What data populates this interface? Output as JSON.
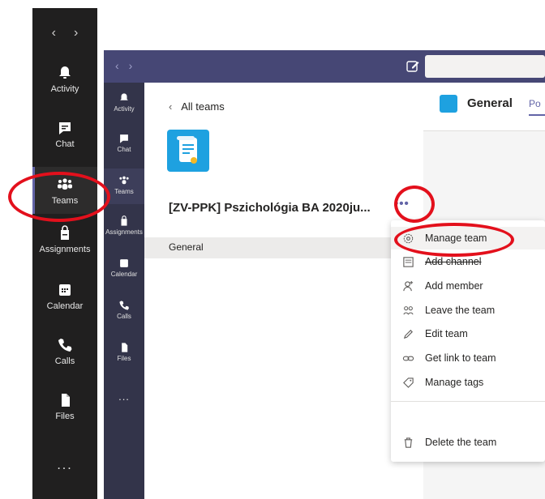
{
  "outer_rail": {
    "items": [
      {
        "label": "Activity",
        "icon": "bell-icon"
      },
      {
        "label": "Chat",
        "icon": "chat-icon"
      },
      {
        "label": "Teams",
        "icon": "teams-icon"
      },
      {
        "label": "Assignments",
        "icon": "assignments-icon"
      },
      {
        "label": "Calendar",
        "icon": "calendar-icon"
      },
      {
        "label": "Calls",
        "icon": "phone-icon"
      },
      {
        "label": "Files",
        "icon": "file-icon"
      }
    ],
    "more": "..."
  },
  "inner_rail": {
    "items": [
      {
        "label": "Activity",
        "icon": "bell-icon"
      },
      {
        "label": "Chat",
        "icon": "chat-icon"
      },
      {
        "label": "Teams",
        "icon": "teams-icon"
      },
      {
        "label": "Assignments",
        "icon": "assignments-icon"
      },
      {
        "label": "Calendar",
        "icon": "calendar-icon"
      },
      {
        "label": "Calls",
        "icon": "phone-icon"
      },
      {
        "label": "Files",
        "icon": "file-icon"
      }
    ],
    "more": "..."
  },
  "team_panel": {
    "back_label": "All teams",
    "team_name": "[ZV-PPK] Pszichológia BA 2020ju...",
    "more_options": "•••",
    "channel": "General"
  },
  "channel_header": {
    "title": "General",
    "tab": "Po"
  },
  "menu": {
    "items": [
      {
        "label": "Manage team",
        "icon": "gear-icon"
      },
      {
        "label": "Add channel",
        "icon": "add-channel-icon"
      },
      {
        "label": "Add member",
        "icon": "add-member-icon"
      },
      {
        "label": "Leave the team",
        "icon": "leave-icon"
      },
      {
        "label": "Edit team",
        "icon": "pencil-icon"
      },
      {
        "label": "Get link to team",
        "icon": "link-icon"
      },
      {
        "label": "Manage tags",
        "icon": "tag-icon"
      },
      {
        "label": "Delete the team",
        "icon": "trash-icon"
      }
    ]
  },
  "colors": {
    "accent": "#6264a7",
    "title_bar": "#464775",
    "annotation_red": "#e3101c",
    "team_icon": "#1ea1e0"
  }
}
